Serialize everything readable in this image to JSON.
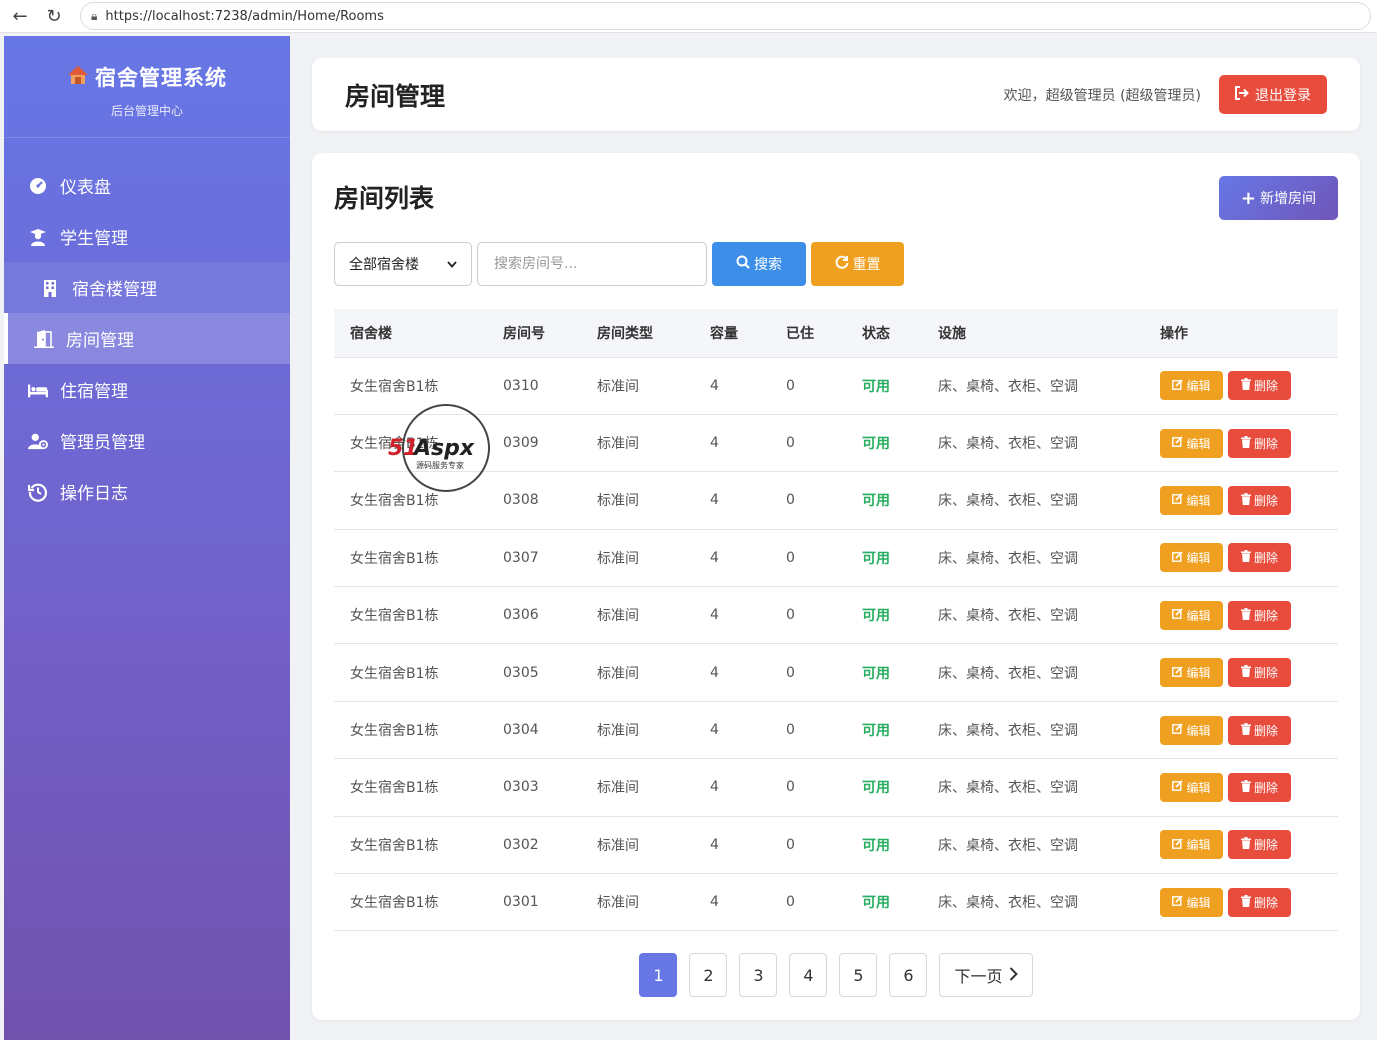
{
  "browser": {
    "url": "https://localhost:7238/admin/Home/Rooms"
  },
  "sidebar": {
    "brand_title": "宿舍管理系统",
    "brand_subtitle": "后台管理中心",
    "items": [
      {
        "label": "仪表盘",
        "icon": "dashboard-icon"
      },
      {
        "label": "学生管理",
        "icon": "student-icon"
      },
      {
        "label": "宿舍楼管理",
        "icon": "building-icon"
      },
      {
        "label": "房间管理",
        "icon": "door-icon"
      },
      {
        "label": "住宿管理",
        "icon": "bed-icon"
      },
      {
        "label": "管理员管理",
        "icon": "admin-icon"
      },
      {
        "label": "操作日志",
        "icon": "history-icon"
      }
    ]
  },
  "header": {
    "title": "房间管理",
    "welcome": "欢迎，超级管理员 (超级管理员)",
    "logout_label": "退出登录"
  },
  "main": {
    "list_title": "房间列表",
    "add_label": "新增房间",
    "filter": {
      "building_selected": "全部宿舍楼",
      "search_placeholder": "搜索房间号...",
      "search_label": "搜索",
      "reset_label": "重置"
    },
    "table": {
      "columns": [
        "宿舍楼",
        "房间号",
        "房间类型",
        "容量",
        "已住",
        "状态",
        "设施",
        "操作"
      ],
      "edit_label": "编辑",
      "delete_label": "删除",
      "rows": [
        {
          "building": "女生宿舍B1栋",
          "room": "0310",
          "type": "标准间",
          "capacity": "4",
          "occupied": "0",
          "status": "可用",
          "facilities": "床、桌椅、衣柜、空调"
        },
        {
          "building": "女生宿舍B1栋",
          "room": "0309",
          "type": "标准间",
          "capacity": "4",
          "occupied": "0",
          "status": "可用",
          "facilities": "床、桌椅、衣柜、空调"
        },
        {
          "building": "女生宿舍B1栋",
          "room": "0308",
          "type": "标准间",
          "capacity": "4",
          "occupied": "0",
          "status": "可用",
          "facilities": "床、桌椅、衣柜、空调"
        },
        {
          "building": "女生宿舍B1栋",
          "room": "0307",
          "type": "标准间",
          "capacity": "4",
          "occupied": "0",
          "status": "可用",
          "facilities": "床、桌椅、衣柜、空调"
        },
        {
          "building": "女生宿舍B1栋",
          "room": "0306",
          "type": "标准间",
          "capacity": "4",
          "occupied": "0",
          "status": "可用",
          "facilities": "床、桌椅、衣柜、空调"
        },
        {
          "building": "女生宿舍B1栋",
          "room": "0305",
          "type": "标准间",
          "capacity": "4",
          "occupied": "0",
          "status": "可用",
          "facilities": "床、桌椅、衣柜、空调"
        },
        {
          "building": "女生宿舍B1栋",
          "room": "0304",
          "type": "标准间",
          "capacity": "4",
          "occupied": "0",
          "status": "可用",
          "facilities": "床、桌椅、衣柜、空调"
        },
        {
          "building": "女生宿舍B1栋",
          "room": "0303",
          "type": "标准间",
          "capacity": "4",
          "occupied": "0",
          "status": "可用",
          "facilities": "床、桌椅、衣柜、空调"
        },
        {
          "building": "女生宿舍B1栋",
          "room": "0302",
          "type": "标准间",
          "capacity": "4",
          "occupied": "0",
          "status": "可用",
          "facilities": "床、桌椅、衣柜、空调"
        },
        {
          "building": "女生宿舍B1栋",
          "room": "0301",
          "type": "标准间",
          "capacity": "4",
          "occupied": "0",
          "status": "可用",
          "facilities": "床、桌椅、衣柜、空调"
        }
      ]
    },
    "pagination": {
      "pages": [
        "1",
        "2",
        "3",
        "4",
        "5",
        "6"
      ],
      "current": "1",
      "next_label": "下一页"
    }
  },
  "watermark": {
    "text": "51Aspx",
    "subtext": "源码服务专家"
  },
  "colors": {
    "accent": "#6777e6",
    "danger": "#e74c3c",
    "warning": "#f0a020",
    "primary": "#3c8ee8",
    "success": "#27ae60"
  }
}
